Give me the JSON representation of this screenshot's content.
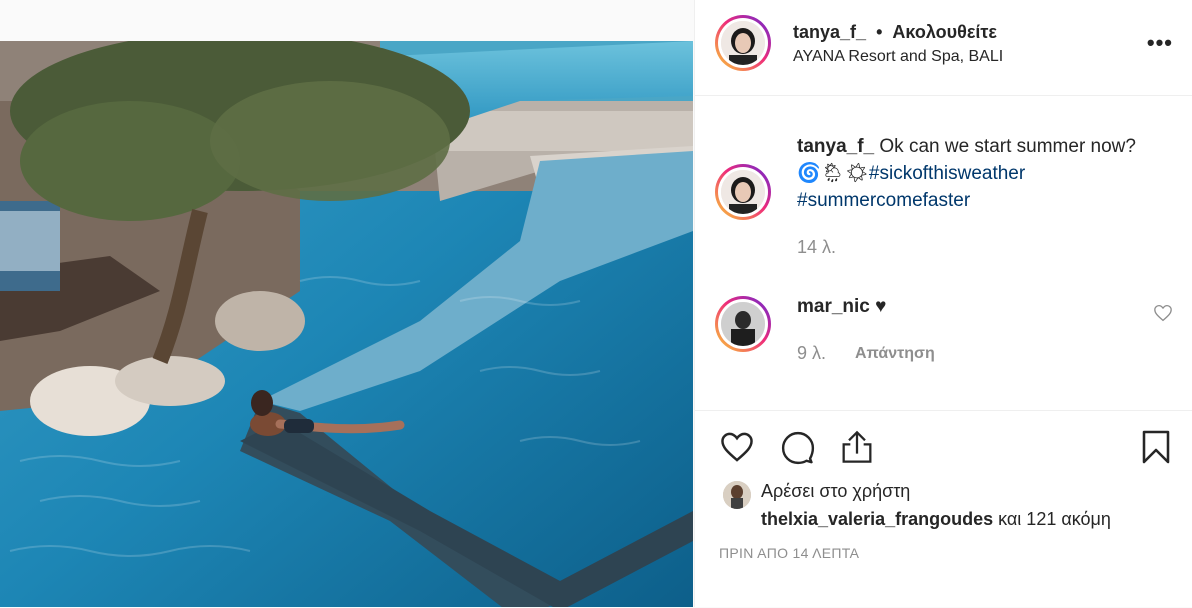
{
  "post": {
    "photo_alt": "",
    "header": {
      "username": "tanya_f_",
      "dot": "•",
      "follow_status": "Ακολουθείτε",
      "location": "AYANA Resort and Spa, BALI",
      "more_icon": "more-options-icon"
    },
    "caption": {
      "username": "tanya_f_",
      "text": "Ok can we start summer now?",
      "emoji": "🌀🌦☀",
      "hashtag1": "#sickofthisweather",
      "hashtag2": "#summercomefaster",
      "age": "14 λ."
    },
    "comments": [
      {
        "username": "mar_nic",
        "text": "♥",
        "age": "9 λ.",
        "reply_label": "Απάντηση"
      }
    ],
    "actions": {
      "like_icon": "heart-icon",
      "comment_icon": "comment-icon",
      "share_icon": "share-icon",
      "save_icon": "bookmark-icon"
    },
    "likes": {
      "line1": "Αρέσει στο χρήστη",
      "liker": "thelxia_valeria_frangoudes",
      "rest": "και 121 ακόμη"
    },
    "timestamp": "ΠΡΙΝ ΑΠΟ 14 ΛΕΠΤΑ"
  }
}
